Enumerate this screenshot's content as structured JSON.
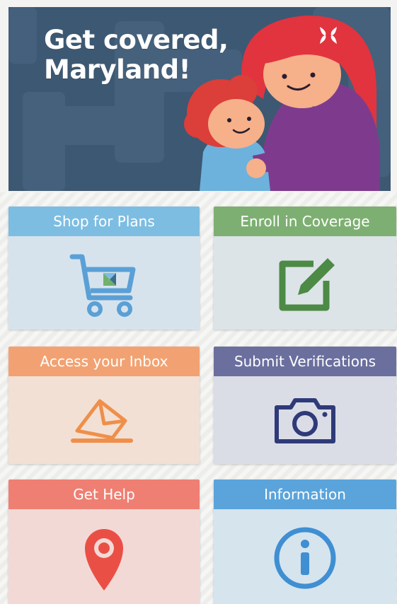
{
  "banner": {
    "headline_line1": "Get covered,",
    "headline_line2": "Maryland!",
    "logo_icon": "maryland-health-connection-x-icon"
  },
  "tiles": [
    {
      "label": "Shop for Plans",
      "icon": "shopping-cart-icon",
      "color": "#7dbde2"
    },
    {
      "label": "Enroll in Coverage",
      "icon": "edit-pencil-icon",
      "color": "#7eaf72"
    },
    {
      "label": "Access your Inbox",
      "icon": "envelope-icon",
      "color": "#f2a272"
    },
    {
      "label": "Submit Verifications",
      "icon": "camera-icon",
      "color": "#6b6f9e"
    },
    {
      "label": "Get Help",
      "icon": "location-pin-icon",
      "color": "#ef7f72"
    },
    {
      "label": "Information",
      "icon": "info-icon",
      "color": "#5aa4db"
    }
  ]
}
